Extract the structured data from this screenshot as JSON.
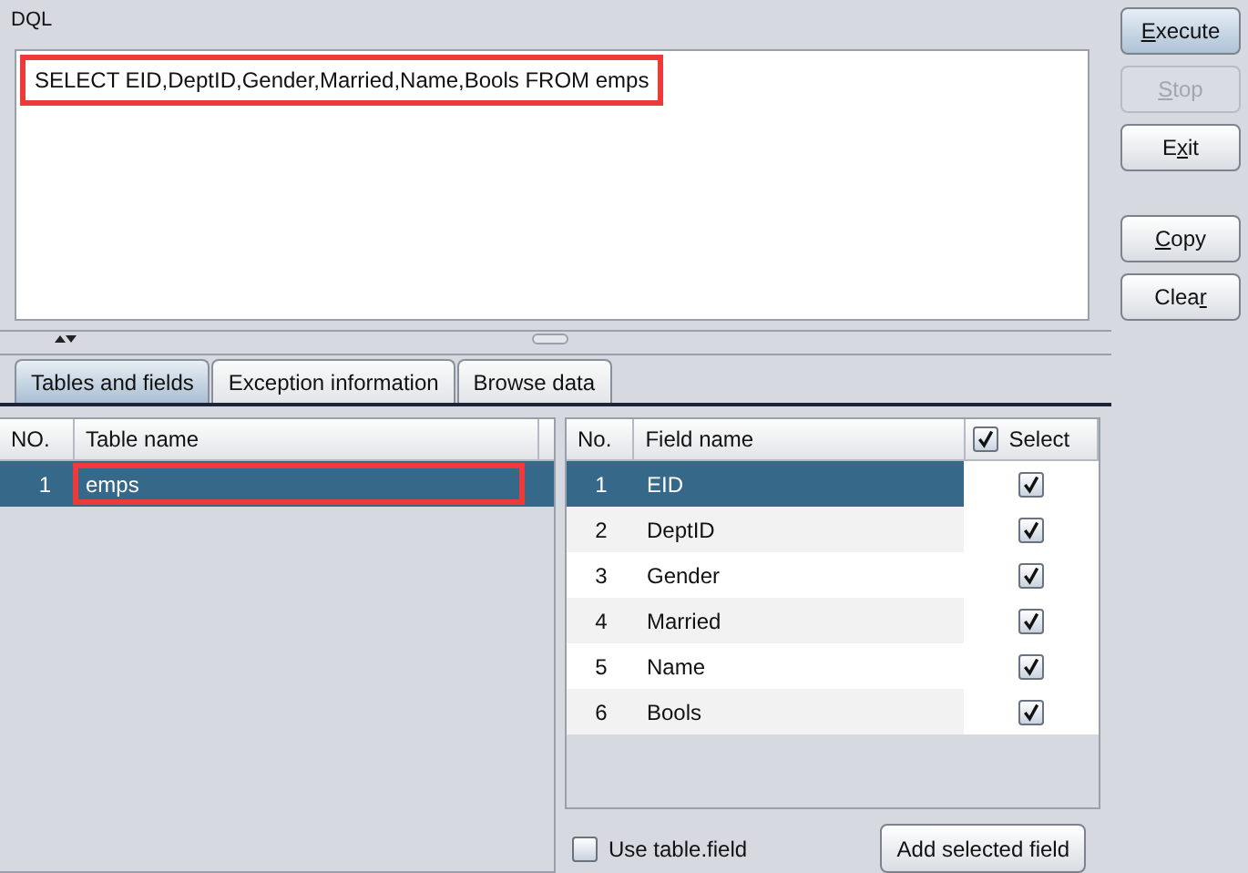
{
  "editor": {
    "label": "DQL",
    "query": "SELECT EID,DeptID,Gender,Married,Name,Bools FROM emps",
    "highlighted": true
  },
  "buttons": [
    {
      "label": [
        {
          "text": "E",
          "underlined": true
        },
        {
          "text": "xecute",
          "underlined": false
        }
      ],
      "disabled": false,
      "focused": true
    },
    {
      "label": [
        {
          "text": "S",
          "underlined": true
        },
        {
          "text": "top",
          "underlined": false
        }
      ],
      "disabled": true,
      "focused": false
    },
    {
      "label": [
        {
          "text": "E",
          "underlined": false
        },
        {
          "text": "x",
          "underlined": true
        },
        {
          "text": "it",
          "underlined": false
        }
      ],
      "disabled": false,
      "focused": false
    },
    {
      "label": [
        {
          "text": "C",
          "underlined": true
        },
        {
          "text": "opy",
          "underlined": false
        }
      ],
      "disabled": false,
      "focused": false
    },
    {
      "label": [
        {
          "text": "Clea",
          "underlined": false
        },
        {
          "text": "r",
          "underlined": true
        }
      ],
      "disabled": false,
      "focused": false
    }
  ],
  "tabs": [
    {
      "label": "Tables and fields",
      "selected": true
    },
    {
      "label": "Exception information",
      "selected": false
    },
    {
      "label": "Browse data",
      "selected": false
    }
  ],
  "tables": {
    "columns": [
      "NO.",
      "Table name"
    ],
    "rows": [
      {
        "no": "1",
        "name": "emps",
        "selected": true,
        "highlighted": true
      }
    ]
  },
  "fields": {
    "columns": [
      "No.",
      "Field name",
      "Select"
    ],
    "select_all": true,
    "rows": [
      {
        "no": "1",
        "name": "EID",
        "selected": true,
        "checked": true
      },
      {
        "no": "2",
        "name": "DeptID",
        "selected": false,
        "checked": true
      },
      {
        "no": "3",
        "name": "Gender",
        "selected": false,
        "checked": true
      },
      {
        "no": "4",
        "name": "Married",
        "selected": false,
        "checked": true
      },
      {
        "no": "5",
        "name": "Name",
        "selected": false,
        "checked": true
      },
      {
        "no": "6",
        "name": "Bools",
        "selected": false,
        "checked": true
      }
    ]
  },
  "use_table_field": {
    "label": "Use table.field",
    "checked": false
  },
  "add_button": {
    "label": "Add selected field"
  }
}
